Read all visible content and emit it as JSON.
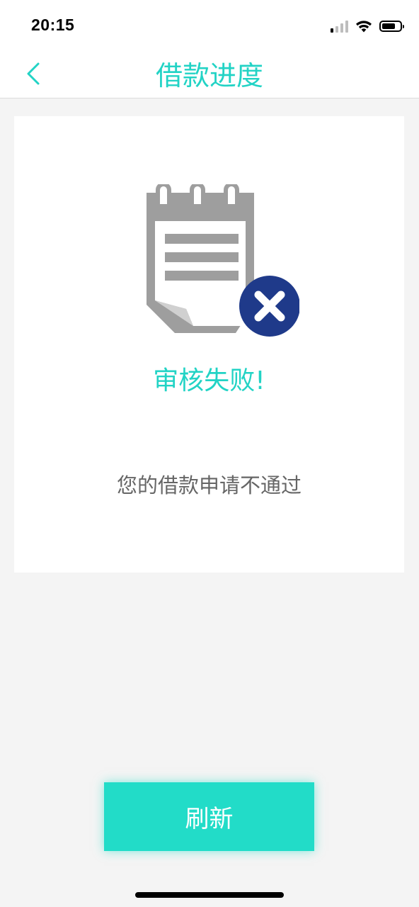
{
  "status_bar": {
    "time": "20:15",
    "signal_bars_active": 1,
    "signal_bars_total": 4,
    "battery_level": 0.75
  },
  "nav": {
    "title": "借款进度",
    "back_icon": "chevron-left-icon"
  },
  "result": {
    "icon": "notepad-error-icon",
    "title": "审核失败!",
    "description": "您的借款申请不通过"
  },
  "actions": {
    "refresh_label": "刷新"
  },
  "colors": {
    "accent": "#22d3c5",
    "button": "#22dcc8",
    "error_badge": "#1f3a8a",
    "icon_gray": "#9e9e9e",
    "text_secondary": "#666666",
    "background": "#f4f4f4"
  }
}
